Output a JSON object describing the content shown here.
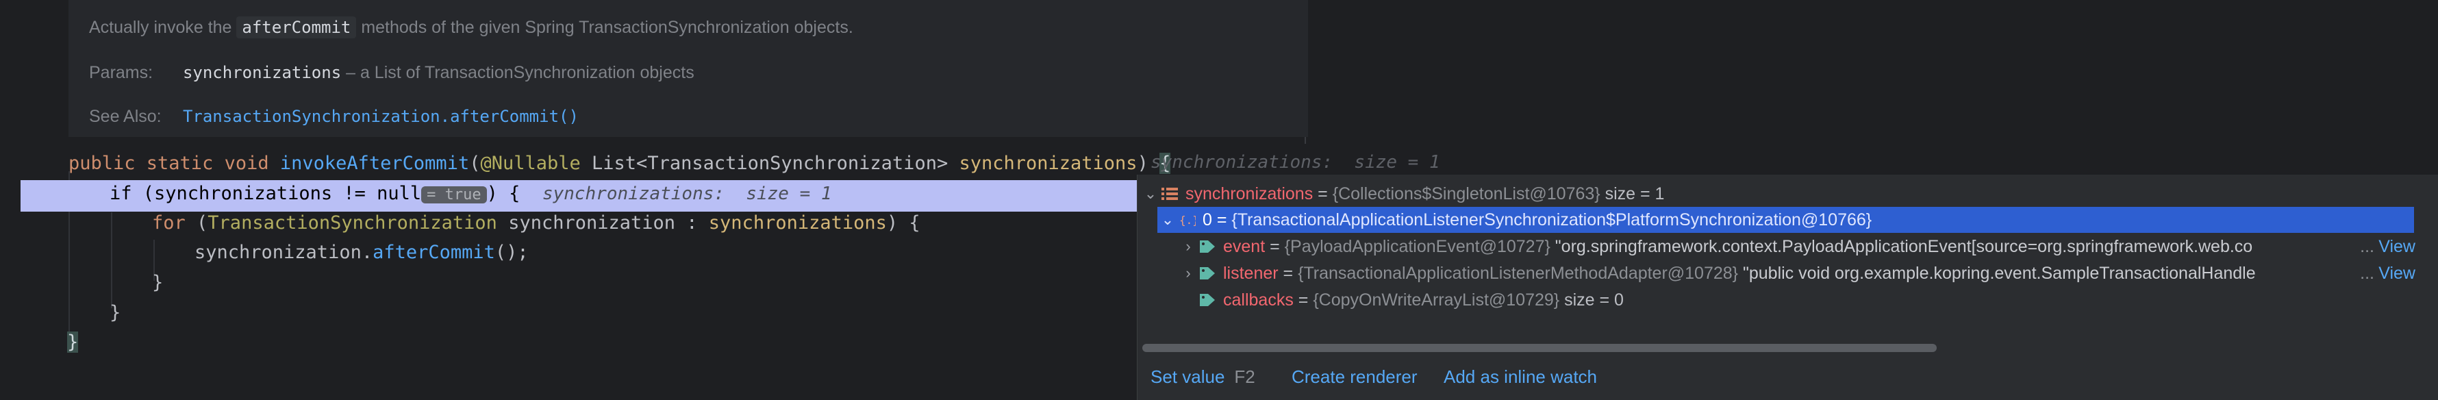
{
  "doc": {
    "summary_prefix": "Actually invoke the",
    "summary_code": "afterCommit",
    "summary_suffix": "methods of the given Spring TransactionSynchronization objects.",
    "params_label": "Params:",
    "params_code": "synchronizations",
    "params_desc": "– a List of TransactionSynchronization objects",
    "see_also_label": "See Also:",
    "see_also_link": "TransactionSynchronization.afterCommit()"
  },
  "code": {
    "l1_kw": "public static void ",
    "l1_fn": "invokeAfterCommit",
    "l1_open": "(",
    "l1_ann": "@Nullable",
    "l1_type": " List<TransactionSynchronization> ",
    "l1_par": "synchronizations",
    "l1_close": ") ",
    "l1_brace": "{",
    "l1_hint": "synchronizations:  size = 1",
    "l2_text": "if (synchronizations != null",
    "l2_chip": "= true",
    "l2_after": ") {",
    "l2_hint": "synchronizations:  size = 1",
    "l3_kw": "for ",
    "l3_open": "(",
    "l3_type": "TransactionSynchronization",
    "l3_mid": " synchronization : ",
    "l3_par": "synchronizations",
    "l3_close": ") {",
    "l4_obj": "synchronization.",
    "l4_fn": "afterCommit",
    "l4_tail": "();",
    "l5": "}",
    "l6": "}",
    "l7": "}"
  },
  "debug": {
    "root_name": "synchronizations",
    "root_eq": " = ",
    "root_ref": "{Collections$SingletonList@10763}",
    "root_size": " size = 1",
    "item_index": "0 = ",
    "item_ref": "{TransactionalApplicationListenerSynchronization$PlatformSynchronization@10766}",
    "event_name": "event",
    "event_ref": "{PayloadApplicationEvent@10727}",
    "event_str": "\"org.springframework.context.PayloadApplicationEvent[source=org.springframework.web.co",
    "listener_name": "listener",
    "listener_ref": "{TransactionalApplicationListenerMethodAdapter@10728}",
    "listener_str": "\"public void org.example.kopring.event.SampleTransactionalHandle",
    "callbacks_name": "callbacks",
    "callbacks_ref": "{CopyOnWriteArrayList@10729}",
    "callbacks_size": " size = 0",
    "ellipsis": "...",
    "view": "View",
    "eq": " = "
  },
  "actions": {
    "set_value": "Set value",
    "set_value_shortcut": "F2",
    "create_renderer": "Create renderer",
    "inline_watch": "Add as inline watch"
  },
  "colors": {
    "background": "#1e1f22",
    "execution_line": "#b9bff5",
    "selected_row": "#2e5fd1",
    "link": "#56a8f5",
    "variable_name": "#f2676f"
  }
}
